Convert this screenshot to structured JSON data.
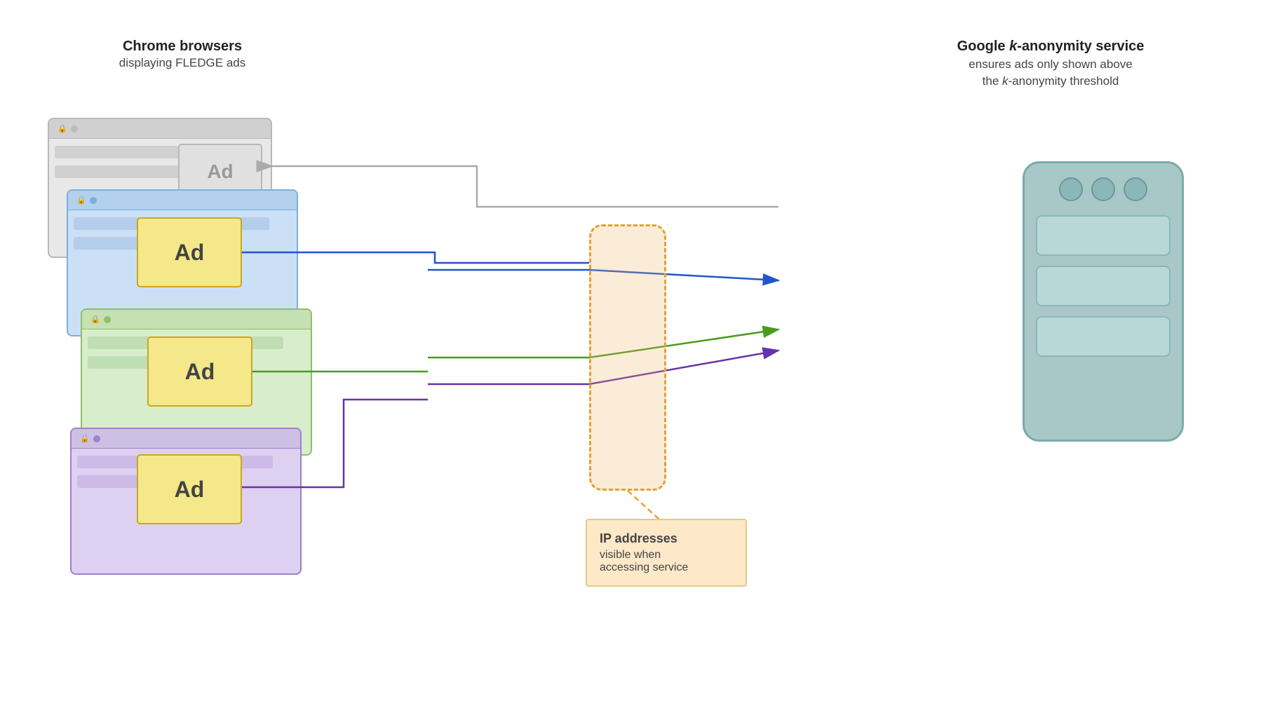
{
  "labels": {
    "chrome_title": "Chrome browsers",
    "chrome_sub": "displaying FLEDGE ads",
    "google_title_pre": "Google ",
    "google_title_k": "k",
    "google_title_post": "-anonymity service",
    "google_sub_line1": "ensures ads only shown above",
    "google_sub_line2": "the ",
    "google_sub_k": "k",
    "google_sub_line2_post": "-anonymity threshold"
  },
  "ad_labels": {
    "ad_grey": "Ad",
    "ad_blue": "Ad",
    "ad_green": "Ad",
    "ad_purple": "Ad"
  },
  "ip_box": {
    "title": "IP addresses",
    "line1": "visible when",
    "line2": "accessing service"
  },
  "colors": {
    "arrow_grey": "#aaaaaa",
    "arrow_blue": "#2255cc",
    "arrow_green": "#4a9a20",
    "arrow_purple": "#6633aa",
    "server_bg": "#a8c8c8",
    "ip_proxy_border": "#e8a030"
  }
}
